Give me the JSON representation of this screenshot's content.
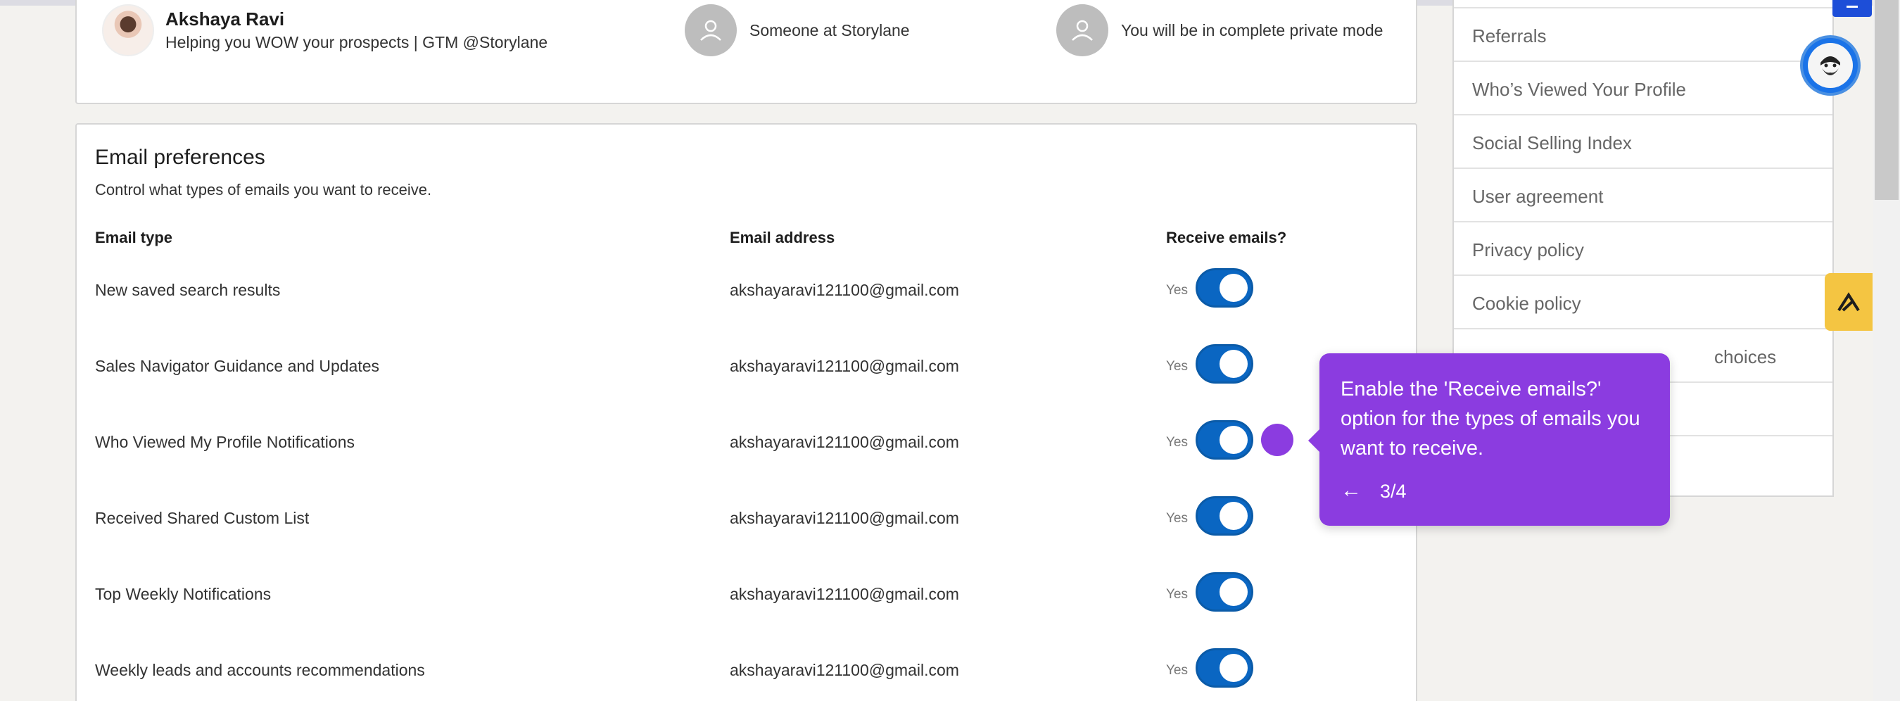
{
  "viewers": [
    {
      "name": "Akshaya Ravi",
      "subtitle": "Helping you WOW your prospects | GTM @Storylane"
    },
    {
      "label": "Someone at Storylane"
    },
    {
      "label": "You will be in complete private mode"
    }
  ],
  "email_prefs": {
    "title": "Email preferences",
    "subtitle": "Control what types of emails you want to receive.",
    "headers": {
      "type": "Email type",
      "address": "Email address",
      "receive": "Receive emails?"
    },
    "rows": [
      {
        "type": "New saved search results",
        "address": "akshayaravi121100@gmail.com",
        "status": "Yes",
        "on": true
      },
      {
        "type": "Sales Navigator Guidance and Updates",
        "address": "akshayaravi121100@gmail.com",
        "status": "Yes",
        "on": true
      },
      {
        "type": "Who Viewed My Profile Notifications",
        "address": "akshayaravi121100@gmail.com",
        "status": "Yes",
        "on": true
      },
      {
        "type": "Received Shared Custom List",
        "address": "akshayaravi121100@gmail.com",
        "status": "Yes",
        "on": true
      },
      {
        "type": "Top Weekly Notifications",
        "address": "akshayaravi121100@gmail.com",
        "status": "Yes",
        "on": true
      },
      {
        "type": "Weekly leads and accounts recommendations",
        "address": "akshayaravi121100@gmail.com",
        "status": "Yes",
        "on": true
      }
    ]
  },
  "sidebar": {
    "items": [
      {
        "label": "Referrals"
      },
      {
        "label": "Who’s Viewed Your Profile"
      },
      {
        "label": "Social Selling Index"
      },
      {
        "label": "User agreement"
      },
      {
        "label": "Privacy policy"
      },
      {
        "label": "Cookie policy"
      },
      {
        "label": "choices"
      },
      {
        "label": ""
      },
      {
        "label": ""
      }
    ]
  },
  "tooltip": {
    "text": "Enable the 'Receive emails?' option for the types of emails you want to receive.",
    "back_icon": "←",
    "step": "3/4"
  },
  "colors": {
    "toggle_on": "#0a66c2",
    "tooltip_bg": "#8b3ce0",
    "accent_yellow": "#f4c542",
    "corner_blue": "#1d4ed8"
  }
}
